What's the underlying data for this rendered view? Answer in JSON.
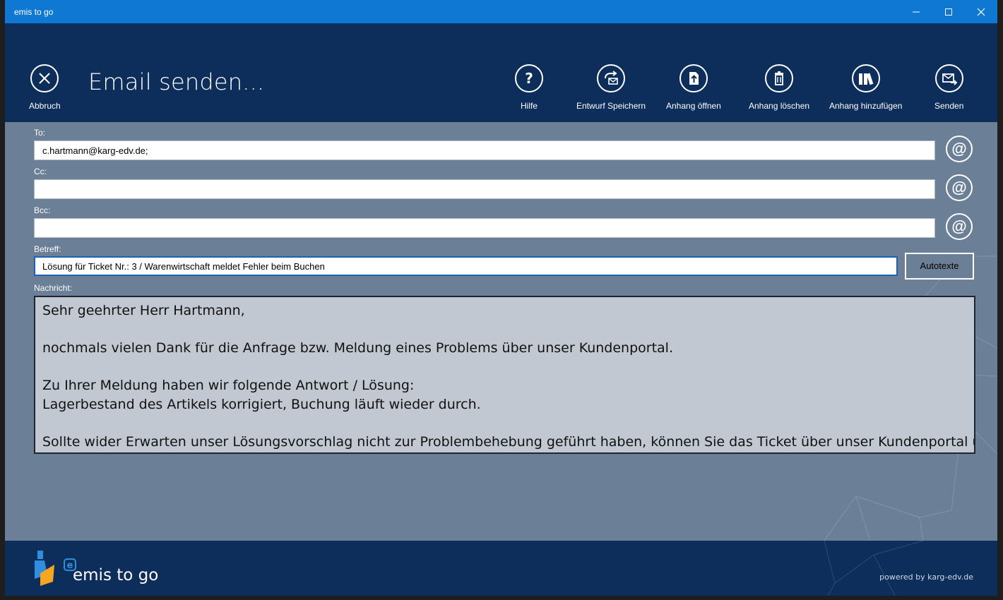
{
  "window": {
    "title": "emis to go"
  },
  "header": {
    "page_title": "Email senden...",
    "cancel_label": "Abbruch",
    "help_label": "Hilfe",
    "save_draft_label": "Entwurf Speichern",
    "open_attachment_label": "Anhang öffnen",
    "delete_attachment_label": "Anhang löschen",
    "add_attachment_label": "Anhang hinzufügen",
    "send_label": "Senden"
  },
  "form": {
    "to_label": "To:",
    "to_value": "c.hartmann@karg-edv.de;",
    "cc_label": "Cc:",
    "cc_value": "",
    "bcc_label": "Bcc:",
    "bcc_value": "",
    "subject_label": "Betreff:",
    "subject_value": "Lösung für Ticket Nr.: 3 / Warenwirtschaft meldet Fehler beim Buchen",
    "autotext_label": "Autotexte",
    "at_symbol": "@",
    "message_label": "Nachricht:",
    "message_lines": [
      "Sehr geehrter Herr Hartmann,",
      "",
      "nochmals vielen Dank für die Anfrage bzw. Meldung eines Problems über unser Kundenportal.",
      "",
      "Zu Ihrer Meldung haben wir folgende Antwort / Lösung:",
      "Lagerbestand des Artikels korrigiert, Buchung läuft wieder durch.",
      "",
      "Sollte wider Erwarten unser Lösungsvorschlag nicht zur Problembehebung geführt haben, können Sie das Ticket über unser Kundenportal unter"
    ]
  },
  "footer": {
    "brand": "emis to go",
    "powered": "powered by karg-edv.de"
  },
  "colors": {
    "titlebar": "#0f78d2",
    "header": "#0d2e5a",
    "content": "#6b7f96",
    "message_bg": "#c2c8d2"
  }
}
